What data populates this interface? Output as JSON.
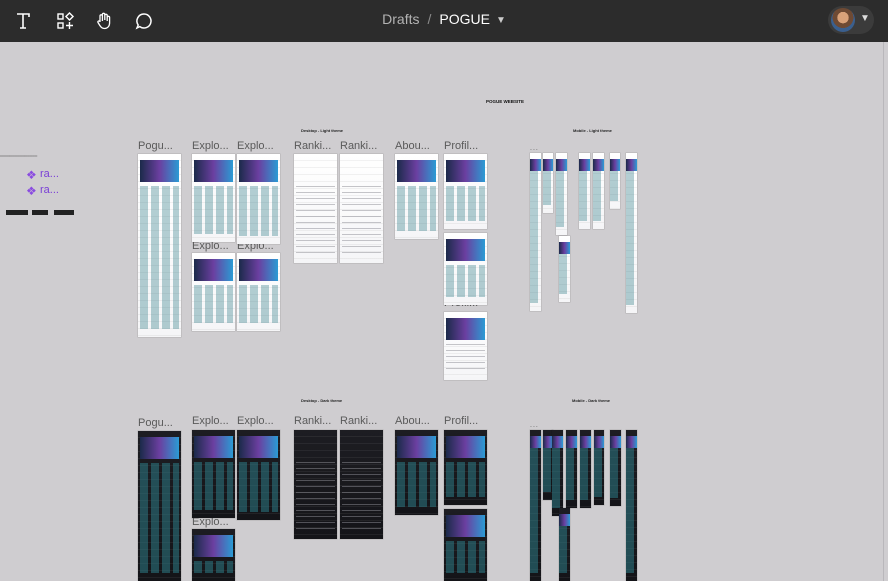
{
  "toolbar": {
    "tools": [
      "text-tool",
      "components-tool",
      "hand-tool",
      "comment-tool"
    ],
    "breadcrumb_parent": "Drafts",
    "breadcrumb_sep": "/",
    "file_name": "POGUE"
  },
  "canvas": {
    "page_title": "POGUE WEBSITE",
    "section_light_desktop": "Desktop - Light theme",
    "section_light_mobile": "Mobile - Light theme",
    "section_dark_desktop": "Desktop - Dark theme",
    "section_dark_mobile": "Mobile - Dark theme",
    "frame_labels_top": [
      "Pogu...",
      "Explo...",
      "Explo...",
      "Ranki...",
      "Ranki...",
      "Abou...",
      "Profil...",
      "Explo...",
      "Explo...",
      "Profil...",
      "Profil..."
    ],
    "frame_labels_bottom": [
      "Pogu...",
      "Explo...",
      "Explo...",
      "Ranki...",
      "Ranki...",
      "Abou...",
      "Profil...",
      "Explo..."
    ],
    "dots": "...",
    "brand_mark": "ra..."
  },
  "colors": {
    "toolbar_bg": "#2c2c2c",
    "canvas_bg": "#cfcdd0",
    "accent_purple": "#8a4be0"
  }
}
